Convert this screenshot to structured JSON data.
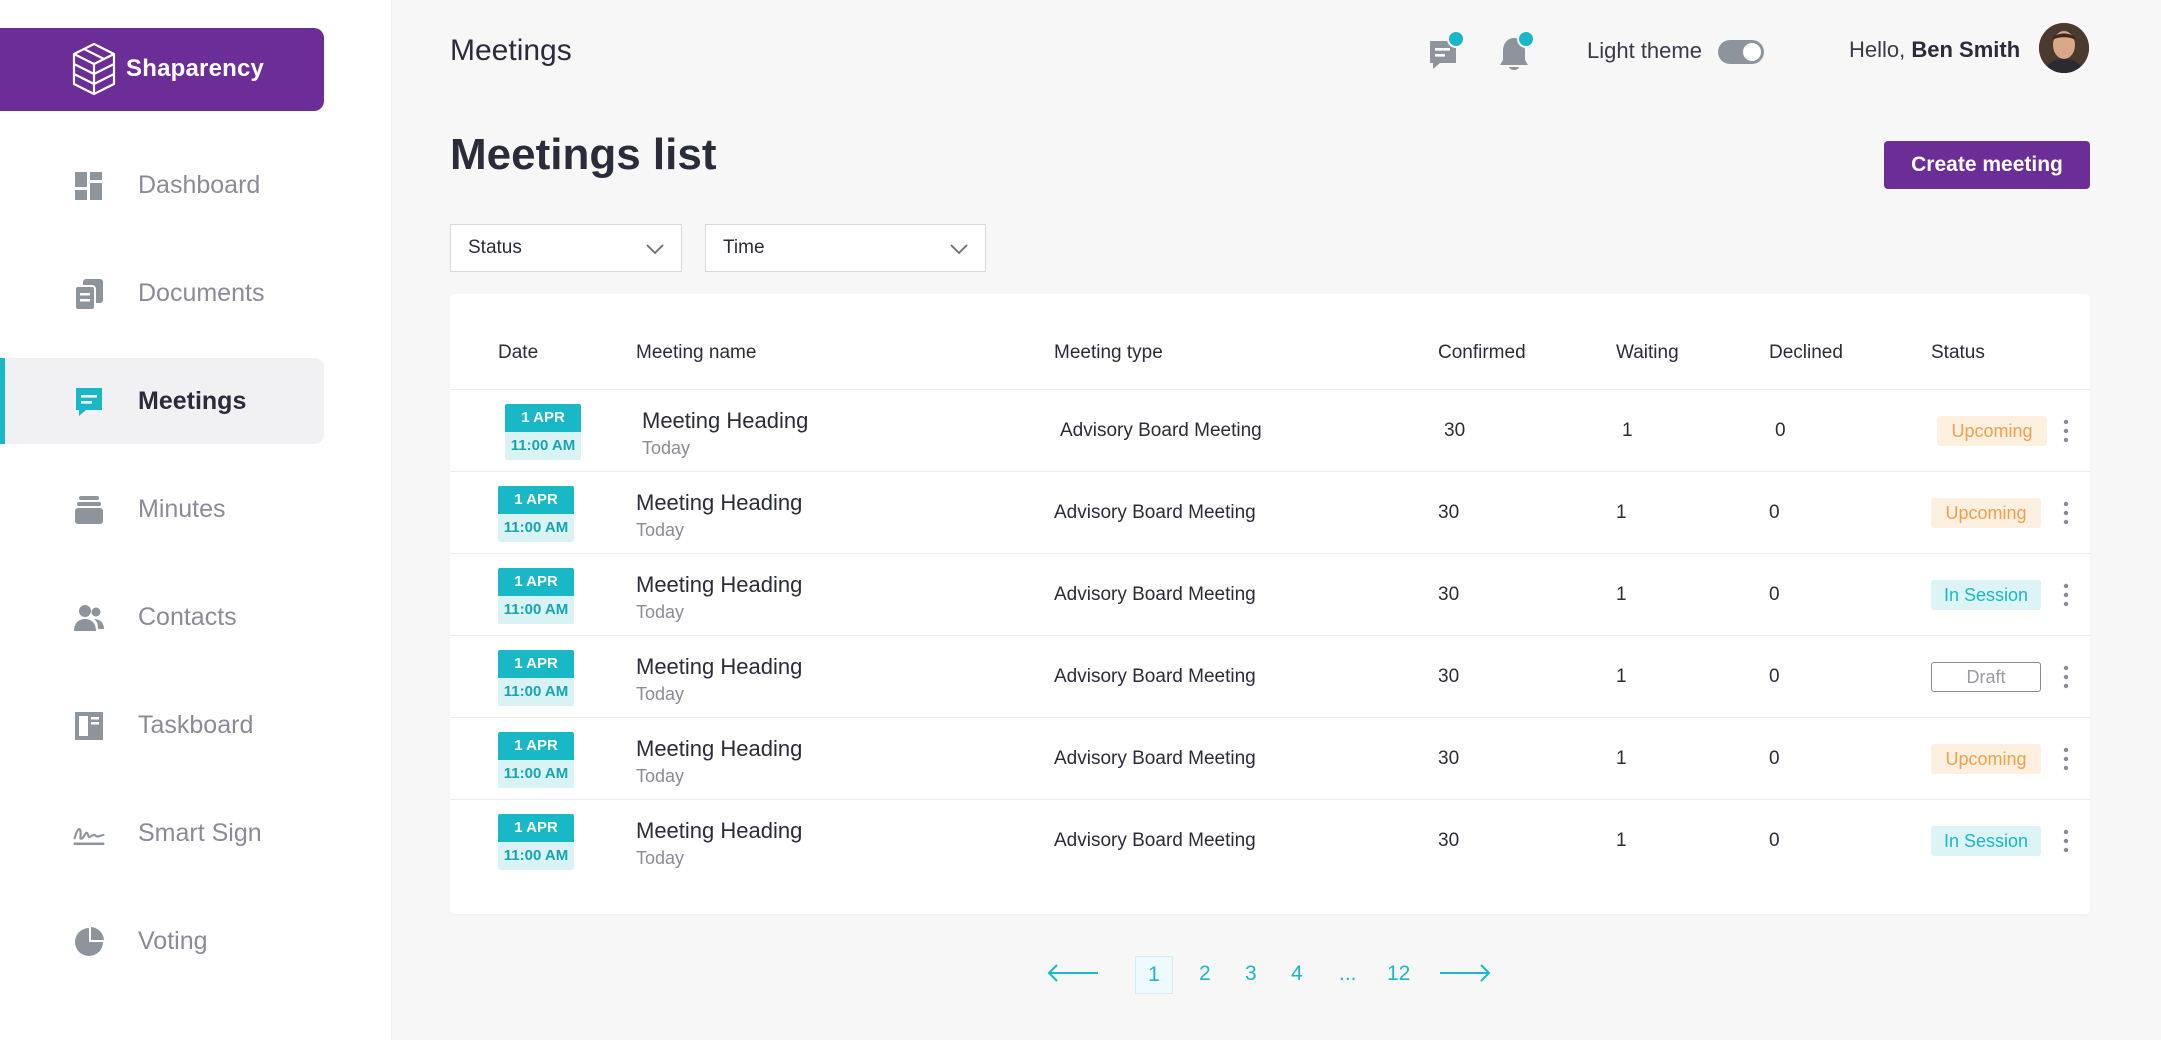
{
  "brand": {
    "name": "Shaparency"
  },
  "sidebar": {
    "items": [
      {
        "label": "Dashboard",
        "icon": "dashboard-icon"
      },
      {
        "label": "Documents",
        "icon": "documents-icon"
      },
      {
        "label": "Meetings",
        "icon": "meetings-icon",
        "active": true
      },
      {
        "label": "Minutes",
        "icon": "minutes-icon"
      },
      {
        "label": "Contacts",
        "icon": "contacts-icon"
      },
      {
        "label": "Taskboard",
        "icon": "taskboard-icon"
      },
      {
        "label": "Smart Sign",
        "icon": "signature-icon"
      },
      {
        "label": "Voting",
        "icon": "pie-chart-icon"
      }
    ]
  },
  "header": {
    "title": "Meetings",
    "theme_label": "Light theme",
    "greeting": "Hello, ",
    "user_name": "Ben Smith"
  },
  "main": {
    "list_title": "Meetings list",
    "create_button": "Create meeting",
    "filters": {
      "status": "Status",
      "time": "Time"
    },
    "columns": {
      "date": "Date",
      "name": "Meeting name",
      "type": "Meeting type",
      "confirmed": "Confirmed",
      "waiting": "Waiting",
      "declined": "Declined",
      "status": "Status"
    },
    "rows": [
      {
        "day": "1 APR",
        "time": "11:00 AM",
        "name": "Meeting Heading",
        "sub": "Today",
        "type": "Advisory Board Meeting",
        "confirmed": "30",
        "waiting": "1",
        "declined": "0",
        "status": "Upcoming",
        "status_kind": "upcoming"
      },
      {
        "day": "1 APR",
        "time": "11:00 AM",
        "name": "Meeting Heading",
        "sub": "Today",
        "type": "Advisory Board Meeting",
        "confirmed": "30",
        "waiting": "1",
        "declined": "0",
        "status": "Upcoming",
        "status_kind": "upcoming"
      },
      {
        "day": "1 APR",
        "time": "11:00 AM",
        "name": "Meeting Heading",
        "sub": "Today",
        "type": "Advisory Board Meeting",
        "confirmed": "30",
        "waiting": "1",
        "declined": "0",
        "status": "In Session",
        "status_kind": "insession"
      },
      {
        "day": "1 APR",
        "time": "11:00 AM",
        "name": "Meeting Heading",
        "sub": "Today",
        "type": "Advisory Board Meeting",
        "confirmed": "30",
        "waiting": "1",
        "declined": "0",
        "status": "Draft",
        "status_kind": "draft"
      },
      {
        "day": "1 APR",
        "time": "11:00 AM",
        "name": "Meeting Heading",
        "sub": "Today",
        "type": "Advisory Board Meeting",
        "confirmed": "30",
        "waiting": "1",
        "declined": "0",
        "status": "Upcoming",
        "status_kind": "upcoming"
      },
      {
        "day": "1 APR",
        "time": "11:00 AM",
        "name": "Meeting Heading",
        "sub": "Today",
        "type": "Advisory Board Meeting",
        "confirmed": "30",
        "waiting": "1",
        "declined": "0",
        "status": "In Session",
        "status_kind": "insession"
      }
    ]
  },
  "pagination": {
    "pages": [
      "1",
      "2",
      "3",
      "4",
      "...",
      "12"
    ],
    "current": "1"
  },
  "colors": {
    "brand": "#6a2e96",
    "accent": "#18b8c6",
    "upcoming": "#f0a04b",
    "upcoming_bg": "#fdf0e1",
    "insession_bg": "#dcf4f6"
  }
}
